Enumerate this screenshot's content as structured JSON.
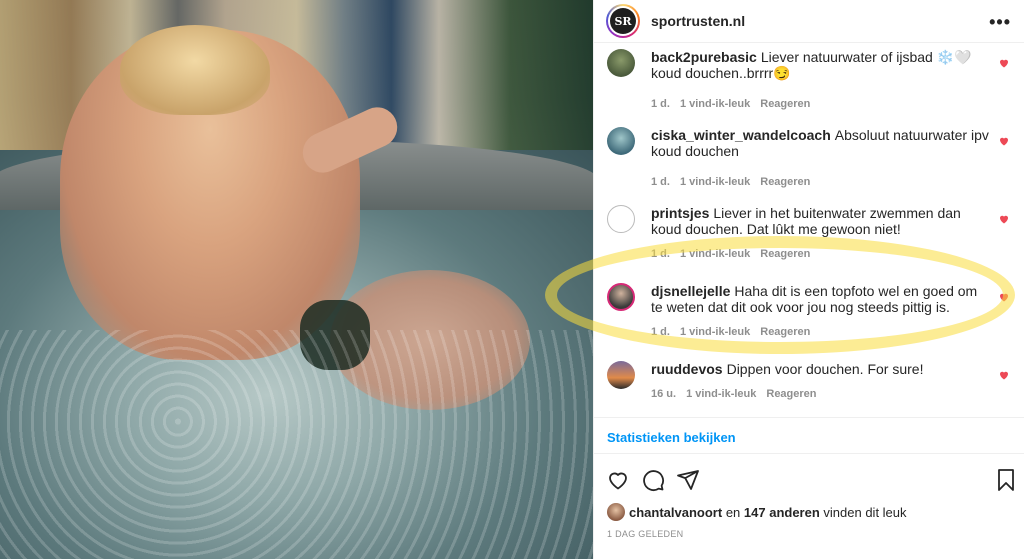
{
  "post": {
    "account": "sportrusten.nl",
    "logo_text": "SR",
    "more_icon": "more-icon",
    "comments": [
      {
        "user": "back2purebasic",
        "text": "Liever natuurwater of ijsbad ❄️🤍 koud douchen..brrrr😏",
        "time": "1 d.",
        "likes": "1 vind-ik-leuk",
        "reply": "Reageren",
        "avatar_color": "#4b5b3c"
      },
      {
        "user": "ciska_winter_wandelcoach",
        "text": "Absoluut natuurwater ipv koud douchen",
        "time": "1 d.",
        "likes": "1 vind-ik-leuk",
        "reply": "Reageren",
        "avatar_color": "#3f6a7a"
      },
      {
        "user": "printsjes",
        "text": "Liever in het buitenwater zwemmen dan koud douchen. Dat lûkt me gewoon niet!",
        "time": "1 d.",
        "likes": "1 vind-ik-leuk",
        "reply": "Reageren",
        "avatar_color": "#ffffff"
      },
      {
        "user": "djsnellejelle",
        "text": "Haha dit is een topfoto wel en goed om te weten dat dit ook voor jou nog steeds pittig is.",
        "time": "1 d.",
        "likes": "1 vind-ik-leuk",
        "reply": "Reageren",
        "avatar_color": "#3a3a3a"
      },
      {
        "user": "ruuddevos",
        "text": "Dippen voor douchen. For sure!",
        "time": "16 u.",
        "likes": "1 vind-ik-leuk",
        "reply": "Reageren",
        "avatar_color": "#c46a3a"
      }
    ],
    "stats_link": "Statistieken bekijken",
    "likes_user": "chantalvanoort",
    "likes_joiner": "en",
    "likes_others": "147 anderen",
    "likes_suffix": "vinden dit leuk",
    "posted": "1 DAG GELEDEN",
    "heart_color": "#ed4956",
    "link_color": "#0095f6",
    "highlight_color": "#fadc3c"
  }
}
